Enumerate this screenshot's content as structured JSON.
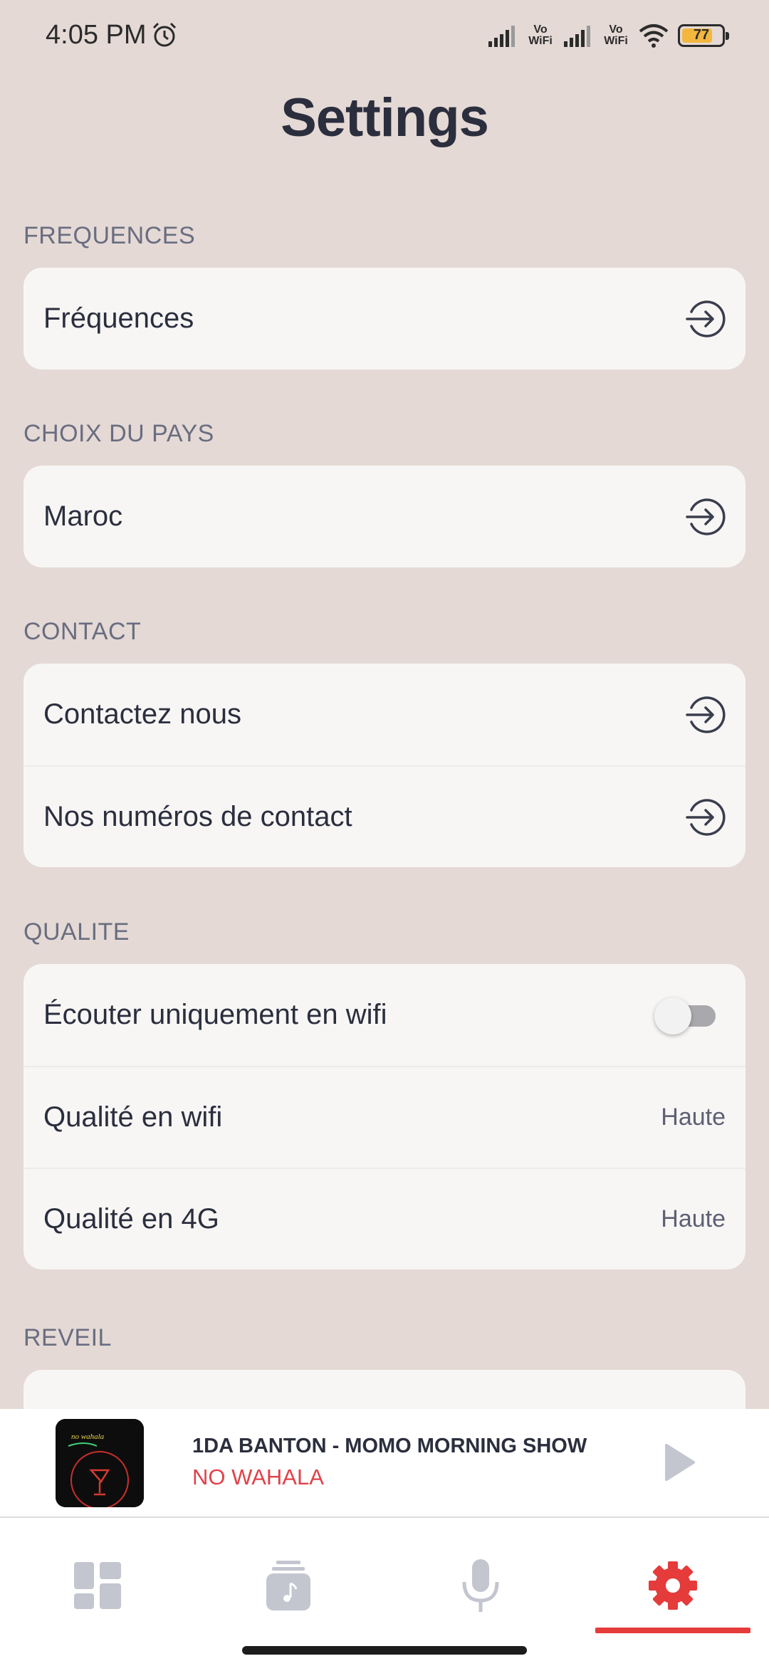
{
  "status_bar": {
    "time": "4:05 PM",
    "battery": "77",
    "battery_level": 0.77,
    "network_badge_1": "Vo WiFi",
    "network_badge_2": "Vo WiFi"
  },
  "page": {
    "title": "Settings"
  },
  "sections": {
    "frequences": {
      "label": "FREQUENCES",
      "items": [
        {
          "label": "Fréquences"
        }
      ]
    },
    "pays": {
      "label": "CHOIX DU PAYS",
      "items": [
        {
          "label": "Maroc"
        }
      ]
    },
    "contact": {
      "label": "CONTACT",
      "items": [
        {
          "label": "Contactez nous"
        },
        {
          "label": "Nos numéros de contact"
        }
      ]
    },
    "qualite": {
      "label": "QUALITE",
      "items": [
        {
          "label": "Écouter uniquement en wifi",
          "toggle_on": false
        },
        {
          "label": "Qualité en wifi",
          "value": "Haute"
        },
        {
          "label": "Qualité en 4G",
          "value": "Haute"
        }
      ]
    },
    "reveil": {
      "label": "REVEIL"
    }
  },
  "now_playing": {
    "title": "1DA BANTON - MOMO MORNING SHOW",
    "subtitle": "NO WAHALA",
    "art_text": "no wahala"
  },
  "tabs": [
    {
      "icon": "dashboard-icon",
      "active": false
    },
    {
      "icon": "music-library-icon",
      "active": false
    },
    {
      "icon": "microphone-icon",
      "active": false
    },
    {
      "icon": "gear-icon",
      "active": true
    }
  ],
  "colors": {
    "background": "#e4d9d5",
    "card": "#f7f6f5",
    "accent": "#e53b3b",
    "muted": "#6a6d80",
    "inactive_tab": "#c3c5cf"
  }
}
